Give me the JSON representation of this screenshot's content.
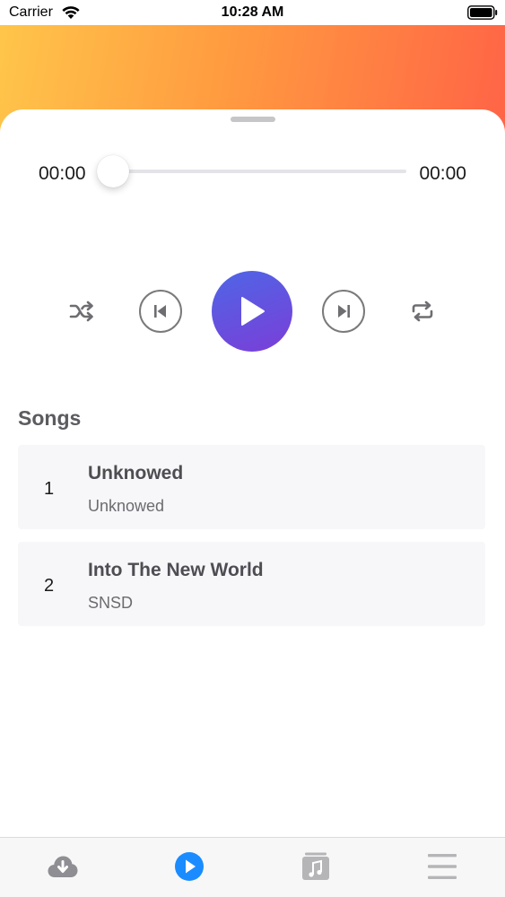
{
  "status_bar": {
    "carrier": "Carrier",
    "time": "10:28 AM"
  },
  "player": {
    "current_time": "00:00",
    "total_time": "00:00",
    "progress": 0
  },
  "songs_section": {
    "title": "Songs",
    "items": [
      {
        "index": "1",
        "title": "Unknowed",
        "artist": "Unknowed"
      },
      {
        "index": "2",
        "title": "Into The New World",
        "artist": "SNSD"
      }
    ]
  },
  "tab_bar": {
    "items": [
      {
        "icon": "cloud-download-icon",
        "active": false
      },
      {
        "icon": "play-circle-icon",
        "active": true
      },
      {
        "icon": "music-library-icon",
        "active": false
      },
      {
        "icon": "menu-icon",
        "active": false
      }
    ],
    "active_color": "#1a8cff",
    "inactive_color": "#b5b5b8"
  },
  "colors": {
    "header_gradient_start": "#ffc54a",
    "header_gradient_end": "#ff6446",
    "play_gradient_start": "#4e66e6",
    "play_gradient_end": "#7b3ed8"
  }
}
